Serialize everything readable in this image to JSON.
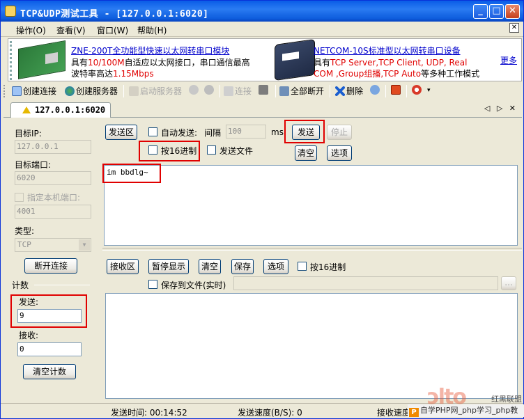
{
  "window": {
    "title": "TCP&UDP测试工具 - [127.0.0.1:6020]"
  },
  "menu": {
    "operate": "操作(O)",
    "view": "查看(V)",
    "window": "窗口(W)",
    "help": "帮助(H)"
  },
  "ad": {
    "left_link": "ZNE-200T全功能型快速以太网转串口模块",
    "left_line2_a": "具有",
    "left_line2_b": "10/100M",
    "left_line2_c": "自适应以太网接口，串口通信最高",
    "left_line3_a": "波特率高达",
    "left_line3_b": "1.15Mbps",
    "right_link": "NETCOM-10S标准型以太网转串口设备",
    "right_line2_a": "具有",
    "right_line2_b": "TCP Server,TCP Client, UDP, Real",
    "right_line3_a": "COM ,Group组播,TCP Auto",
    "right_line3_b": "等多种工作模式",
    "more": "更多"
  },
  "toolbar": {
    "create_conn": "创建连接",
    "create_server": "创建服务器",
    "start_server": "启动服务器",
    "connect": "连接",
    "disconnect_all": "全部断开",
    "delete": "删除"
  },
  "tab": {
    "label": "127.0.0.1:6020",
    "nav": "◁ ▷ ✕"
  },
  "left": {
    "target_ip_label": "目标IP:",
    "target_ip": "127.0.0.1",
    "target_port_label": "目标端口:",
    "target_port": "6020",
    "local_port_label": "指定本机端口:",
    "local_port": "4001",
    "type_label": "类型:",
    "type_value": "TCP",
    "disconnect_btn": "断开连接",
    "count_label": "计数",
    "send_label": "发送:",
    "send_count": "9",
    "recv_label": "接收:",
    "recv_count": "0",
    "clear_count_btn": "清空计数"
  },
  "send": {
    "area_btn": "发送区",
    "auto_send": "自动发送:",
    "interval_label": "间隔",
    "interval_value": "100",
    "ms": "ms",
    "send_btn": "发送",
    "stop_btn": "停止",
    "hex_label": "按16进制",
    "send_file": "发送文件",
    "clear_btn": "清空",
    "options_btn": "选项",
    "content": "im bbdlg~"
  },
  "recv": {
    "area_btn": "接收区",
    "pause_btn": "暂停显示",
    "clear_btn": "清空",
    "save_btn": "保存",
    "options_btn": "选项",
    "hex_label": "按16进制",
    "save_file_label": "保存到文件(实时)",
    "browse": "..."
  },
  "status": {
    "send_time": "发送时间: 00:14:52",
    "send_speed": "发送速度(B/S): 0",
    "recv_speed": "接收速度"
  },
  "watermark": {
    "big": "ɔlto",
    "small": "红黑联盟",
    "bar_logo": "P",
    "bar_text": "自学PHP网_php学习_php教"
  },
  "colors": {
    "title_bar": "#0a5ce6",
    "highlight": "#e00000",
    "link": "#0000cc"
  }
}
